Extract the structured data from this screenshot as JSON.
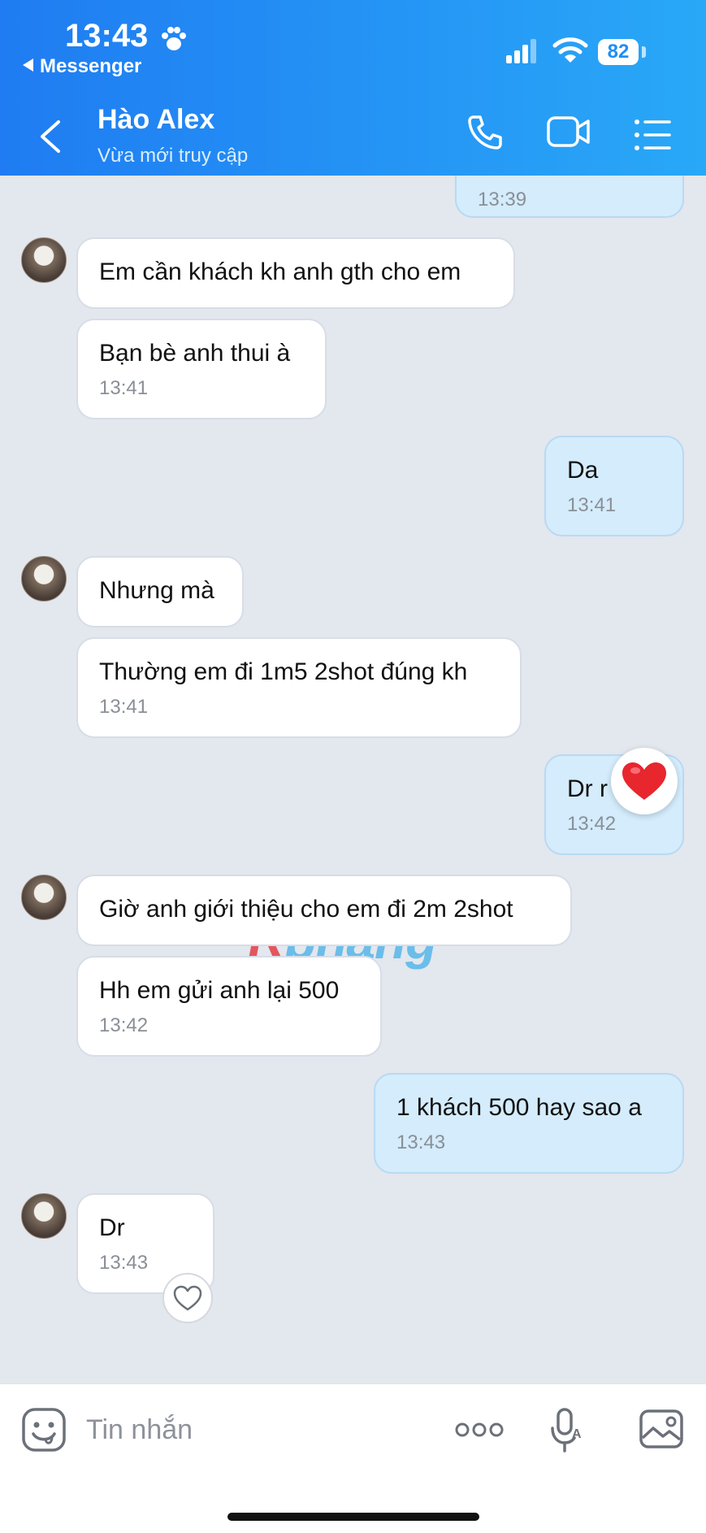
{
  "status_bar": {
    "time": "13:43",
    "back_app": "Messenger",
    "battery": "82"
  },
  "header": {
    "name": "Hào Alex",
    "status": "Vừa mới truy cập"
  },
  "messages": [
    {
      "dir": "out",
      "time": "13:39"
    },
    {
      "dir": "in",
      "text": "Em cần khách kh anh gth cho em"
    },
    {
      "dir": "in",
      "text": "Bạn bè anh thui à",
      "time": "13:41"
    },
    {
      "dir": "out",
      "text": "Da",
      "time": "13:41"
    },
    {
      "dir": "in",
      "text": "Nhưng mà"
    },
    {
      "dir": "in",
      "text": "Thường em đi 1m5 2shot đúng kh",
      "time": "13:41"
    },
    {
      "dir": "out",
      "text": "Dr r",
      "time": "13:42",
      "reaction": "heart"
    },
    {
      "dir": "in",
      "text": "Giờ anh giới thiệu cho em đi 2m 2shot"
    },
    {
      "dir": "in",
      "text": "Hh em gửi anh lại 500",
      "time": "13:42"
    },
    {
      "dir": "out",
      "text": "1 khách 500 hay sao a",
      "time": "13:43"
    },
    {
      "dir": "in",
      "text": "Dr",
      "time": "13:43"
    }
  ],
  "watermark": {
    "r": "R",
    "rest": "phang"
  },
  "composer": {
    "placeholder": "Tin nhắn"
  },
  "icons": {
    "back": "chevron-left-icon",
    "call": "phone-icon",
    "video": "video-icon",
    "menu": "list-icon",
    "emoji": "emoji-icon",
    "more": "more-icon",
    "mic": "voice-icon",
    "image": "image-icon"
  }
}
